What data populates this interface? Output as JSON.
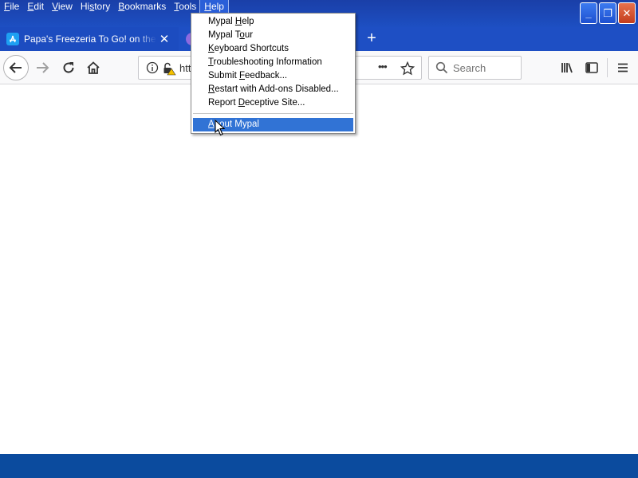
{
  "menubar": {
    "items": [
      {
        "pre": "",
        "u": "F",
        "post": "ile"
      },
      {
        "pre": "",
        "u": "E",
        "post": "dit"
      },
      {
        "pre": "",
        "u": "V",
        "post": "iew"
      },
      {
        "pre": "Hi",
        "u": "s",
        "post": "tory"
      },
      {
        "pre": "",
        "u": "B",
        "post": "ookmarks"
      },
      {
        "pre": "",
        "u": "T",
        "post": "ools"
      },
      {
        "pre": "",
        "u": "H",
        "post": "elp"
      }
    ]
  },
  "window_controls": {
    "minimize": "_",
    "restore": "❐",
    "close": "✕"
  },
  "tabs": {
    "active_title": "Papa's Freezeria To Go! on the App Store",
    "close_glyph": "✕",
    "new_tab_glyph": "+"
  },
  "navbar": {
    "url_partial": "htt",
    "page_actions_glyph": "•••",
    "search_placeholder": "Search"
  },
  "help_menu": {
    "items": [
      {
        "pre": "Mypal ",
        "u": "H",
        "post": "elp",
        "highlighted": false
      },
      {
        "pre": "Mypal T",
        "u": "o",
        "post": "ur",
        "highlighted": false
      },
      {
        "pre": "",
        "u": "K",
        "post": "eyboard Shortcuts",
        "highlighted": false
      },
      {
        "pre": "",
        "u": "T",
        "post": "roubleshooting Information",
        "highlighted": false
      },
      {
        "pre": "Submit ",
        "u": "F",
        "post": "eedback...",
        "highlighted": false
      },
      {
        "pre": "",
        "u": "R",
        "post": "estart with Add-ons Disabled...",
        "highlighted": false
      },
      {
        "pre": "Report ",
        "u": "D",
        "post": "eceptive Site...",
        "highlighted": false
      },
      {
        "pre": "",
        "u": "A",
        "post": "bout Mypal",
        "highlighted": true
      }
    ]
  },
  "colors": {
    "titlebar": "#1d4fc2",
    "menu_highlight": "#3173d5",
    "taskbar": "#0b4b9e"
  }
}
